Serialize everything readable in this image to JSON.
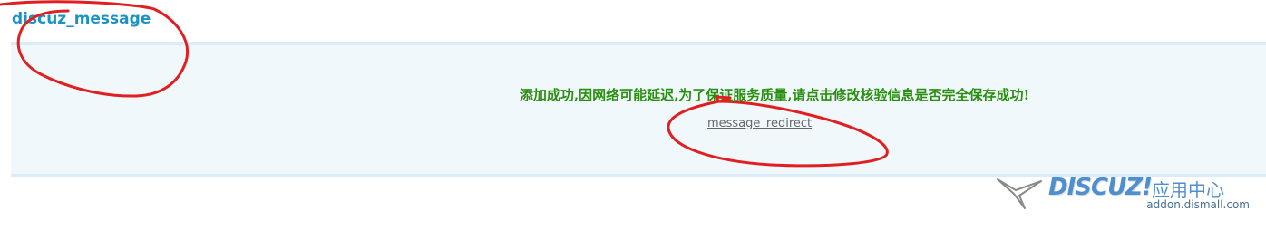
{
  "page": {
    "title": "discuz_message"
  },
  "message": {
    "text": "添加成功,因网络可能延迟,为了保证服务质量,请点击修改核验信息是否完全保存成功!",
    "redirect_link": "message_redirect"
  },
  "watermark": {
    "brand": "DISCUZ!",
    "suffix": "应用中心",
    "domain": "addon.dismall.com"
  },
  "colors": {
    "title": "#1a93c4",
    "message_text": "#2a8f10",
    "panel_background": "#f1f8fc",
    "panel_border": "#d9ecf8",
    "annotation": "#e02020",
    "watermark": "#4f8fd0"
  },
  "icons": {
    "watermark_logo": "discuz-bird-logo-icon"
  }
}
